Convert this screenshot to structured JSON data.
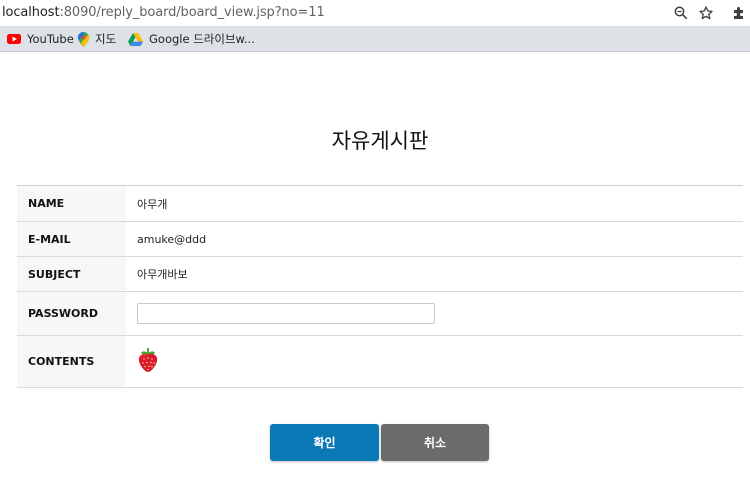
{
  "browser": {
    "url_host": "localhost",
    "url_path": ":8090/reply_board/board_view.jsp?no=11",
    "bookmarks": [
      {
        "label": "YouTube",
        "icon": "youtube-icon"
      },
      {
        "label": "지도",
        "icon": "maps-icon"
      },
      {
        "label": "Google 드라이브w...",
        "icon": "drive-icon"
      }
    ]
  },
  "page": {
    "title": "자유게시판"
  },
  "form": {
    "name_label": "NAME",
    "name_value": "아무개",
    "email_label": "E-MAIL",
    "email_value": "amuke@ddd",
    "subject_label": "SUBJECT",
    "subject_value": "아무개바보",
    "password_label": "PASSWORD",
    "password_value": "",
    "contents_label": "CONTENTS",
    "contents_icon": "strawberry-icon"
  },
  "buttons": {
    "ok_label": "확인",
    "cancel_label": "취소"
  },
  "colors": {
    "ok_button": "#0b79b5",
    "cancel_button": "#6b6b6b"
  }
}
